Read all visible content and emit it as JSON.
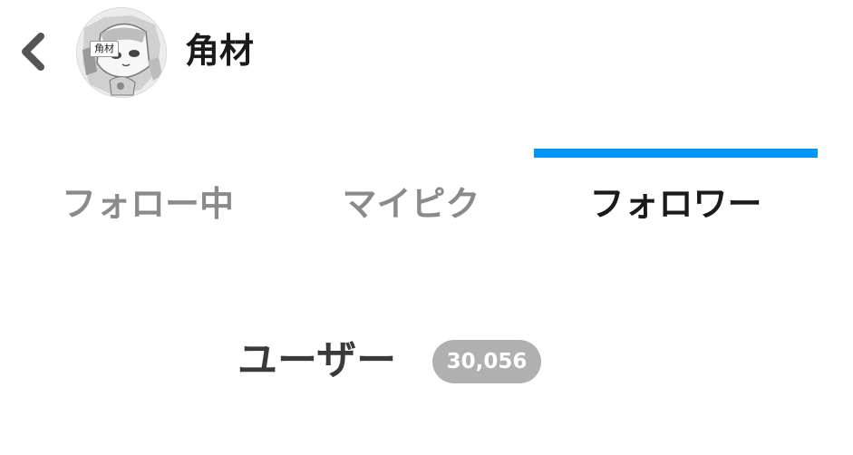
{
  "header": {
    "back_icon": "chevron-left-icon",
    "user_name": "角材",
    "avatar": {
      "tag_text": "角材",
      "description_icon": "avatar-illustration"
    }
  },
  "tabs": [
    {
      "label": "フォロー中",
      "active": false
    },
    {
      "label": "マイピク",
      "active": false
    },
    {
      "label": "フォロワー",
      "active": true
    }
  ],
  "section": {
    "title": "ユーザー",
    "count": "30,056"
  },
  "colors": {
    "accent": "#0096fa",
    "text_primary": "#1a1a1a",
    "text_inactive": "#8a8a8a",
    "badge_bg": "#b0b0b0"
  }
}
